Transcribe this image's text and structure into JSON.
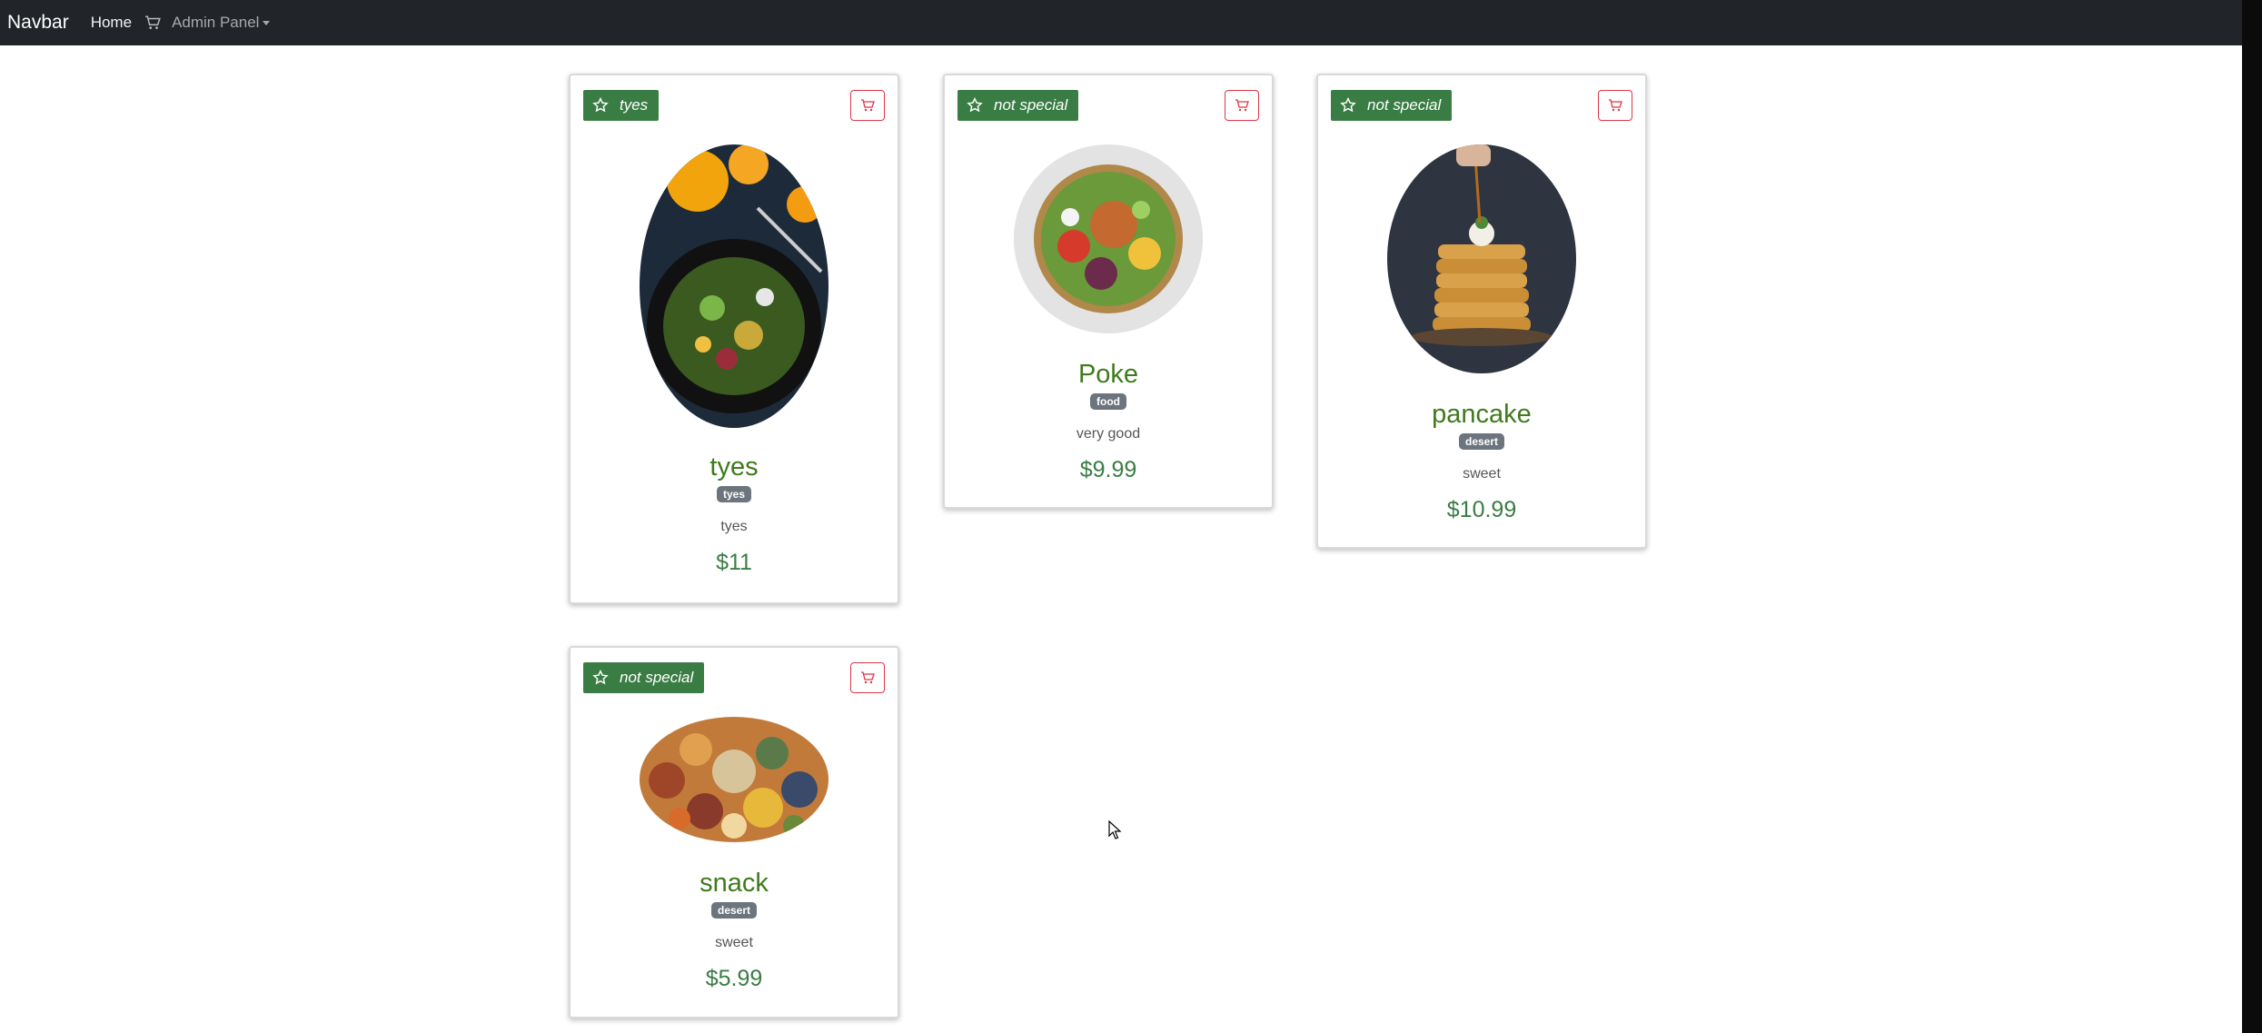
{
  "navbar": {
    "brand": "Navbar",
    "home": "Home",
    "admin": "Admin Panel",
    "cart_icon": "cart-icon"
  },
  "colors": {
    "navbar_bg": "#212529",
    "special_badge": "#3a7d44",
    "title": "#3f7a1c",
    "cart_outline": "#dc3545",
    "tag_bg": "#6c757d"
  },
  "products": [
    {
      "badge": "tyes",
      "name": "tyes",
      "category": "tyes",
      "description": "tyes",
      "price": "$11",
      "image": "salad-plate-photo"
    },
    {
      "badge": "not special",
      "name": "Poke",
      "category": "food",
      "description": "very good",
      "price": "$9.99",
      "image": "poke-bowl-photo"
    },
    {
      "badge": "not special",
      "name": "pancake",
      "category": "desert",
      "description": "sweet",
      "price": "$10.99",
      "image": "pancake-stack-photo"
    },
    {
      "badge": "not special",
      "name": "snack",
      "category": "desert",
      "description": "sweet",
      "price": "$5.99",
      "image": "snack-spread-photo"
    }
  ]
}
